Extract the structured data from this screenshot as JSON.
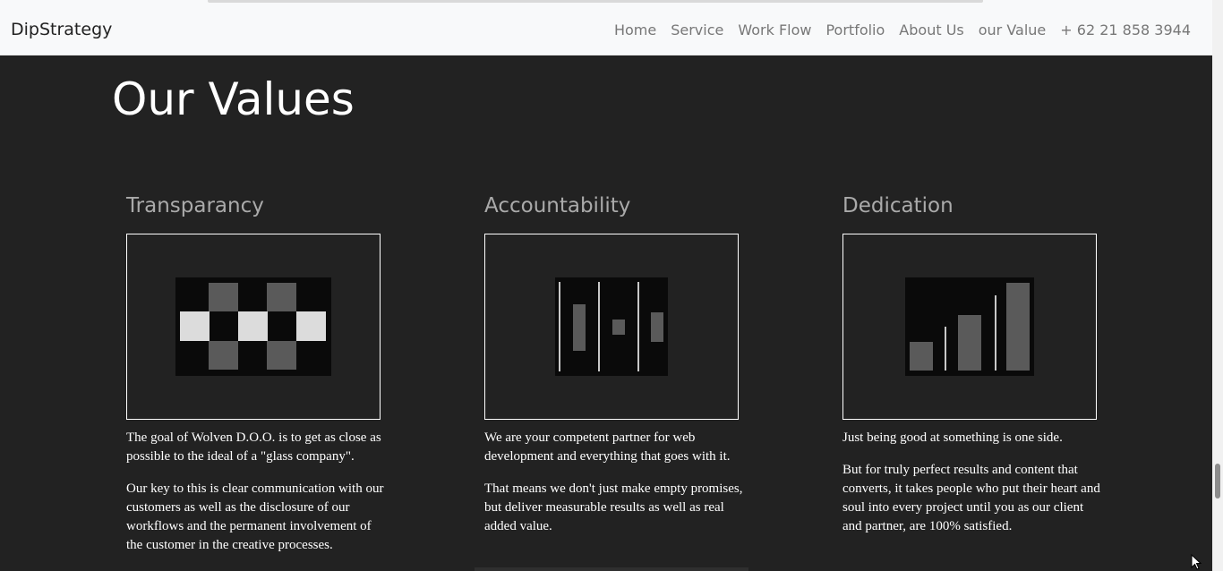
{
  "navbar": {
    "brand": "DipStrategy",
    "links": [
      "Home",
      "Service",
      "Work Flow",
      "Portfolio",
      "About Us",
      "our Value",
      "+ 62 21 858 3944"
    ]
  },
  "page": {
    "title": "Our Values"
  },
  "values": [
    {
      "title": "Transparancy",
      "icon": "checkerboard-icon",
      "paragraphs": [
        "The goal of Wolven D.O.O. is to get as close as possible to the ideal of a \"glass company\".",
        "Our key to this is clear communication with our customers as well as the disclosure of our workflows and the permanent involvement of the customer in the creative processes."
      ]
    },
    {
      "title": "Accountability",
      "icon": "vertical-bars-icon",
      "paragraphs": [
        "We are your competent partner for web development and everything that goes with it.",
        "That means we don't just make empty promises, but deliver measurable results as well as real added value."
      ]
    },
    {
      "title": "Dedication",
      "icon": "growth-bars-icon",
      "paragraphs": [
        "Just being good at something is one side.",
        "But for truly perfect results and content that converts, it takes people who put their heart and soul into every project until you as our client and partner, are 100% satisfied."
      ]
    }
  ],
  "colors": {
    "background": "#222222",
    "navbar": "#f8f9fa",
    "heading": "#aaaaaa",
    "text": "#ffffff",
    "nav_link": "#777777"
  }
}
